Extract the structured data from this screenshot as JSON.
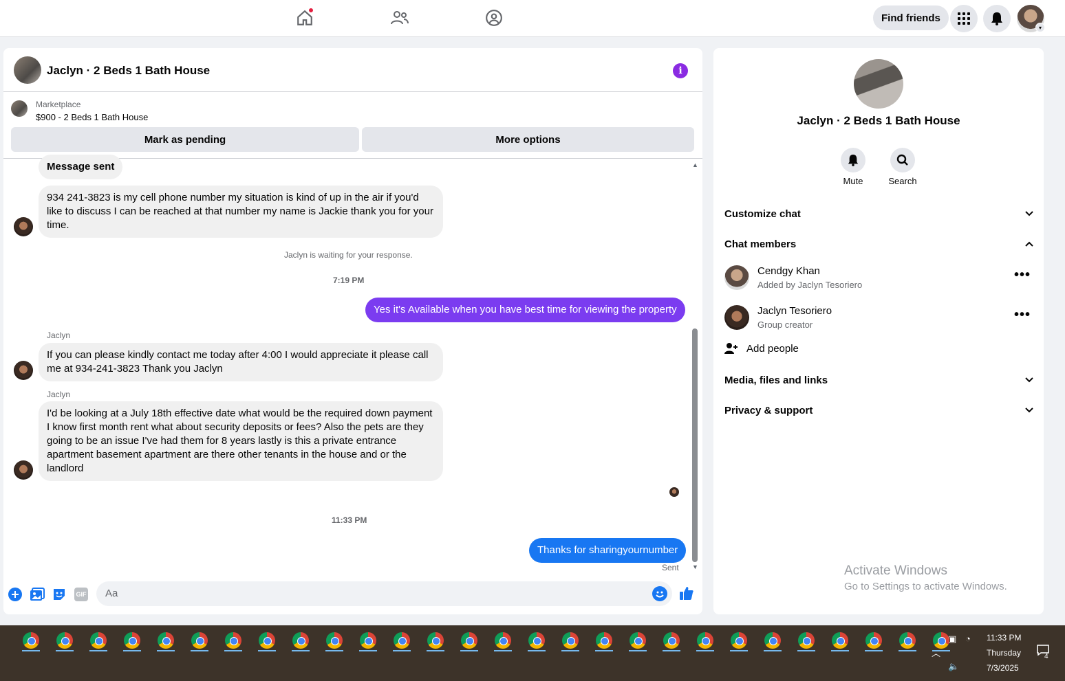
{
  "topbar": {
    "find_friends": "Find friends",
    "icons": [
      "home-icon",
      "friends-icon",
      "groups-icon",
      "menu-grid-icon",
      "bell-icon"
    ]
  },
  "chat": {
    "title": "Jaclyn · 2 Beds 1 Bath House",
    "marketplace_label": "Marketplace",
    "listing": "$900 - 2 Beds 1 Bath House",
    "mark_pending": "Mark as pending",
    "more_options": "More options",
    "messages": {
      "m0": "Message sent",
      "m1": "934 241-3823 is my cell phone number my situation is kind of up in the air if you'd like to discuss I can be reached at that number my name is Jackie thank you for your time.",
      "waiting": "Jaclyn is waiting for your response.",
      "time1": "7:19 PM",
      "m2": "Yes it's Available when you have best time for viewing the property",
      "sender1": "Jaclyn",
      "m3": "If you can please kindly contact me today after 4:00 I would appreciate it please call me at 934-241-3823 Thank you Jaclyn",
      "sender2": "Jaclyn",
      "m4": "I'd be looking at a July 18th effective date what would be the required down payment I know first month rent what about security deposits or fees? Also the pets are they going to be an issue I've had them for 8 years lastly is this a private entrance apartment basement apartment are there other tenants in the house and or the landlord",
      "time2": "11:33 PM",
      "m5": "Thanks for sharingyournumber",
      "sent": "Sent"
    },
    "composer": {
      "placeholder": "Aa",
      "gif": "GIF"
    }
  },
  "info": {
    "title": "Jaclyn · 2 Beds 1 Bath House",
    "mute": "Mute",
    "search": "Search",
    "customize": "Customize chat",
    "members_header": "Chat members",
    "members": [
      {
        "name": "Cendgy Khan",
        "sub": "Added by Jaclyn Tesoriero"
      },
      {
        "name": "Jaclyn Tesoriero",
        "sub": "Group creator"
      }
    ],
    "add_people": "Add people",
    "media": "Media, files and links",
    "privacy": "Privacy & support",
    "watermark_title": "Activate Windows",
    "watermark_sub": "Go to Settings to activate Windows."
  },
  "taskbar": {
    "time": "11:33 PM",
    "day": "Thursday",
    "date": "7/3/2025",
    "notif_count": "4"
  },
  "colors": {
    "accent_purple": "#7b3cf0",
    "accent_blue": "#1877f2"
  }
}
